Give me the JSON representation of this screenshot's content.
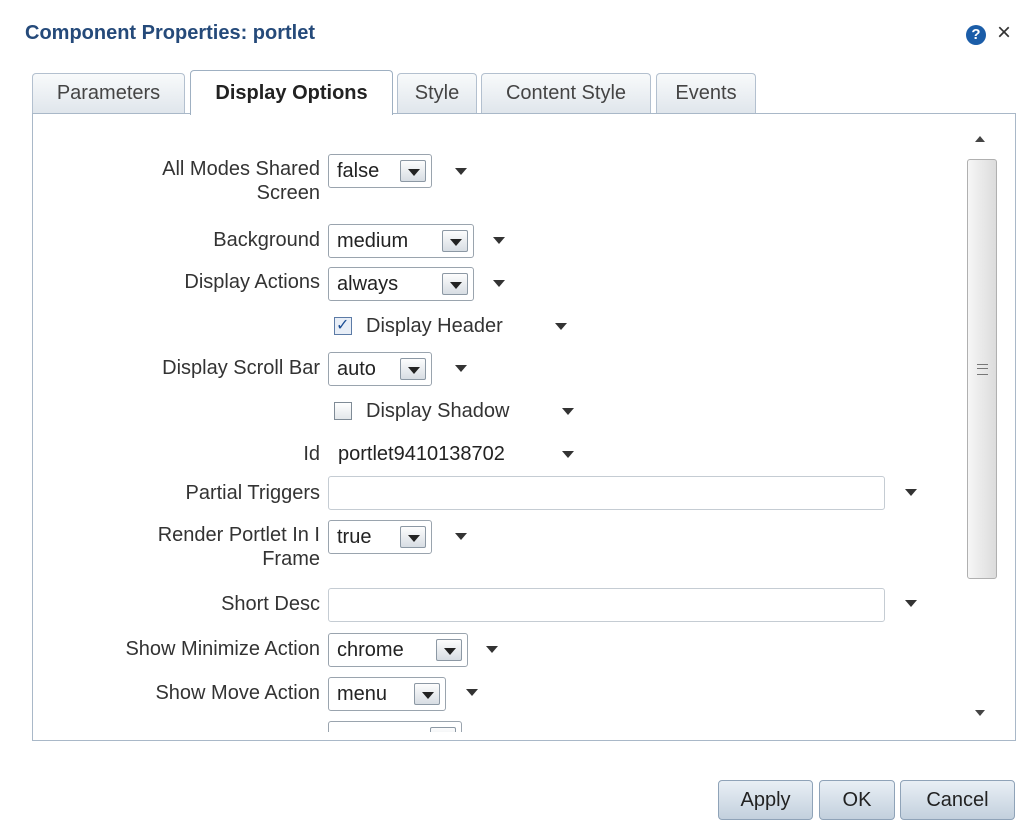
{
  "dialog": {
    "title": "Component Properties: portlet",
    "help_icon": "help-icon",
    "help_glyph": "?",
    "close_icon": "close-icon",
    "close_glyph": "×"
  },
  "tabs": [
    {
      "label": "Parameters",
      "active": false
    },
    {
      "label": "Display Options",
      "active": true
    },
    {
      "label": "Style",
      "active": false
    },
    {
      "label": "Content Style",
      "active": false
    },
    {
      "label": "Events",
      "active": false
    }
  ],
  "fields": {
    "all_modes_shared_screen": {
      "label_line1": "All Modes Shared",
      "label_line2": "Screen",
      "value": "false"
    },
    "background": {
      "label": "Background",
      "value": "medium"
    },
    "display_actions": {
      "label": "Display Actions",
      "value": "always"
    },
    "display_header": {
      "label": "Display Header",
      "checked": true,
      "check_glyph": "✓"
    },
    "display_scroll_bar": {
      "label": "Display Scroll Bar",
      "value": "auto"
    },
    "display_shadow": {
      "label": "Display Shadow",
      "checked": false
    },
    "id": {
      "label": "Id",
      "value": "portlet9410138702"
    },
    "partial_triggers": {
      "label": "Partial Triggers",
      "value": ""
    },
    "render_portlet_in_iframe": {
      "label_line1": "Render Portlet In I",
      "label_line2": "Frame",
      "value": "true"
    },
    "short_desc": {
      "label": "Short Desc",
      "value": ""
    },
    "show_minimize_action": {
      "label": "Show Minimize Action",
      "value": "chrome"
    },
    "show_move_action": {
      "label": "Show Move Action",
      "value": "menu"
    }
  },
  "buttons": {
    "apply": "Apply",
    "ok": "OK",
    "cancel": "Cancel"
  },
  "colors": {
    "title": "#254a7a",
    "help_icon": "#1b5da8",
    "button_border": "#8fa3b8"
  }
}
